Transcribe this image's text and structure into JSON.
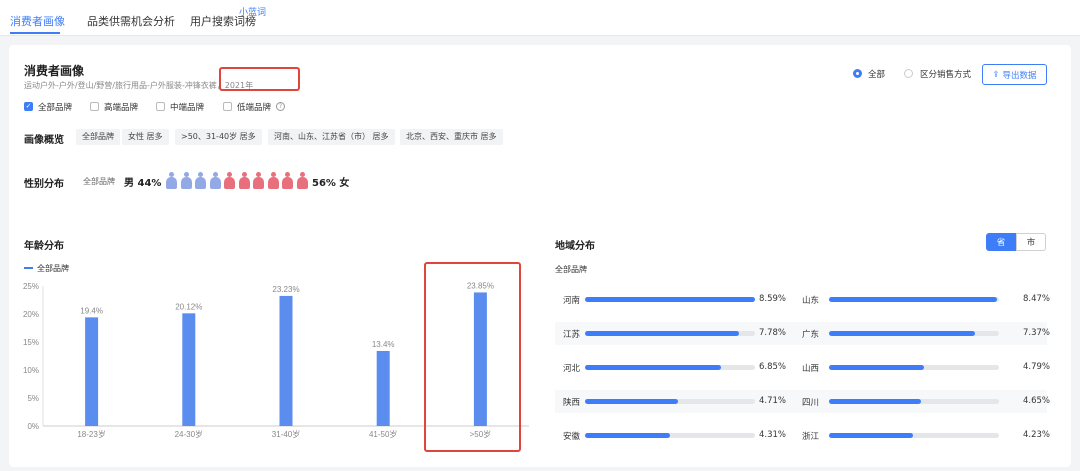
{
  "nav": {
    "tabs": [
      "消费者画像",
      "品类供需机会分析",
      "用户搜索词榜"
    ],
    "active_tab": 0,
    "badge": "小蓝词"
  },
  "header": {
    "title": "消费者画像",
    "subtitle": "运动户外-户外/登山/野营/旅行用品-户外服装-冲锋衣裤，2021年",
    "scope_options": [
      "全部",
      "区分销售方式"
    ],
    "selected_scope": "全部",
    "export_label": "导出数据"
  },
  "filters": {
    "brand_tiers": [
      {
        "label": "全部品牌",
        "checked": true
      },
      {
        "label": "高端品牌",
        "checked": false
      },
      {
        "label": "中端品牌",
        "checked": false
      },
      {
        "label": "低端品牌",
        "checked": false
      }
    ]
  },
  "overview": {
    "label": "画像概览",
    "chips": [
      "全部品牌",
      "女性 居多",
      ">50、31-40岁 居多",
      "河南、山东、江苏省（市） 居多",
      "北京、西安、重庆市 居多"
    ]
  },
  "gender": {
    "label": "性别分布",
    "brand": "全部品牌",
    "male_text": "男 44%",
    "female_text": "56% 女",
    "male_icons": 4,
    "female_icons": 6,
    "male_color": "#93a9e6",
    "female_color": "#e8707d"
  },
  "age": {
    "label": "年龄分布",
    "legend": "全部品牌"
  },
  "chart_data": {
    "type": "bar",
    "categories": [
      "18-23岁",
      "24-30岁",
      "31-40岁",
      "41-50岁",
      ">50岁"
    ],
    "series": [
      {
        "name": "全部品牌",
        "values": [
          19.4,
          20.12,
          23.23,
          13.4,
          23.85
        ]
      }
    ],
    "data_labels": [
      "19.4%",
      "20.12%",
      "23.23%",
      "13.4%",
      "23.85%"
    ],
    "y_ticks": [
      "0%",
      "5%",
      "10%",
      "15%",
      "20%",
      "25%"
    ],
    "ylim": [
      0,
      25
    ],
    "grid": false,
    "bar_color": "#5b8def"
  },
  "region": {
    "label": "地域分布",
    "toggles": [
      "省",
      "市"
    ],
    "selected_toggle": "省",
    "sub": "全部品牌",
    "rows": [
      {
        "left": {
          "name": "河南",
          "value": "8.59%",
          "pct": 8.59
        },
        "right": {
          "name": "山东",
          "value": "8.47%",
          "pct": 8.47
        }
      },
      {
        "left": {
          "name": "江苏",
          "value": "7.78%",
          "pct": 7.78
        },
        "right": {
          "name": "广东",
          "value": "7.37%",
          "pct": 7.37
        }
      },
      {
        "left": {
          "name": "河北",
          "value": "6.85%",
          "pct": 6.85
        },
        "right": {
          "name": "山西",
          "value": "4.79%",
          "pct": 4.79
        }
      },
      {
        "left": {
          "name": "陕西",
          "value": "4.71%",
          "pct": 4.71
        },
        "right": {
          "name": "四川",
          "value": "4.65%",
          "pct": 4.65
        }
      },
      {
        "left": {
          "name": "安徽",
          "value": "4.31%",
          "pct": 4.31
        },
        "right": {
          "name": "浙江",
          "value": "4.23%",
          "pct": 4.23
        }
      }
    ]
  },
  "accent": "#3d7ef8",
  "annotation_color": "#e0443a"
}
